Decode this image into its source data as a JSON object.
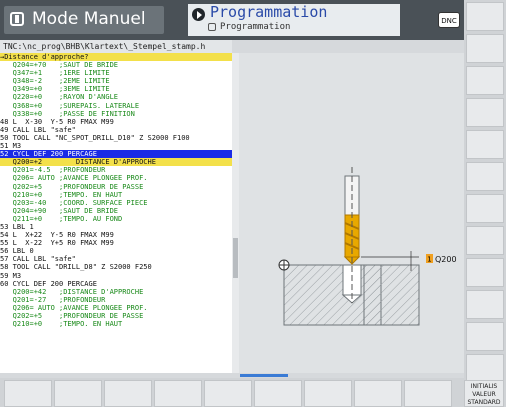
{
  "header": {
    "mode_label": "Mode Manuel",
    "program_title": "Programmation",
    "program_subtitle": "Programmation",
    "dnc_label": "DNC"
  },
  "path": "TNC:\\nc_prog\\BHB\\Klartext\\_Stempel_stamp.h",
  "program_lines": [
    {
      "text": "→Distance d'approche?",
      "style": "hdr"
    },
    {
      "text": "   Q204=+70   ;SAUT DE BRIDE",
      "style": "cm"
    },
    {
      "text": "   Q347=+1    ;1ERE LIMITE",
      "style": "cm"
    },
    {
      "text": "   Q348=-2    ;2EME LIMITE",
      "style": "cm"
    },
    {
      "text": "   Q349=+0    ;3EME LIMITE",
      "style": "cm"
    },
    {
      "text": "   Q220=+0    ;RAYON D'ANGLE",
      "style": "cm"
    },
    {
      "text": "   Q368=+0    ;SUREPAIS. LATERALE",
      "style": "cm"
    },
    {
      "text": "   Q338=+0    ;PASSE DE FINITION",
      "style": "cm"
    },
    {
      "text": "48 L  X-30  Y-5 R0 FMAX M99",
      "style": "n"
    },
    {
      "text": "49 CALL LBL \"safe\"",
      "style": "n"
    },
    {
      "text": "50 TOOL CALL \"NC_SPOT_DRILL_D10\" Z S2000 F100",
      "style": "n"
    },
    {
      "text": "51 M3",
      "style": "n"
    },
    {
      "text": "52 CYCL DEF 200 PERCAGE",
      "style": "cur"
    },
    {
      "text": "   Q200=+2        DISTANCE D'APPROCHE",
      "style": "hdr"
    },
    {
      "text": "   Q201=-4.5  ;PROFONDEUR",
      "style": "cm"
    },
    {
      "text": "   Q206= AUTO ;AVANCE PLONGEE PROF.",
      "style": "cm"
    },
    {
      "text": "   Q202=+5    ;PROFONDEUR DE PASSE",
      "style": "cm"
    },
    {
      "text": "   Q210=+0    ;TEMPO. EN HAUT",
      "style": "cm"
    },
    {
      "text": "   Q203=-40   ;COORD. SURFACE PIECE",
      "style": "cm"
    },
    {
      "text": "   Q204=+90   ;SAUT DE BRIDE",
      "style": "cm"
    },
    {
      "text": "   Q211=+0    ;TEMPO. AU FOND",
      "style": "cm"
    },
    {
      "text": "53 LBL 1",
      "style": "n"
    },
    {
      "text": "54 L  X+22  Y-5 R0 FMAX M99",
      "style": "n"
    },
    {
      "text": "55 L  X-22  Y+5 R0 FMAX M99",
      "style": "n"
    },
    {
      "text": "56 LBL 0",
      "style": "n"
    },
    {
      "text": "57 CALL LBL \"safe\"",
      "style": "n"
    },
    {
      "text": "58 TOOL CALL \"DRILL_D8\" Z S2000 F250",
      "style": "n"
    },
    {
      "text": "59 M3",
      "style": "n"
    },
    {
      "text": "60 CYCL DEF 200 PERCAGE",
      "style": "n"
    },
    {
      "text": "   Q200=+42   ;DISTANCE D'APPROCHE",
      "style": "cm"
    },
    {
      "text": "   Q201=-27   ;PROFONDEUR",
      "style": "cm"
    },
    {
      "text": "   Q206= AUTO ;AVANCE PLONGEE PROF.",
      "style": "cm"
    },
    {
      "text": "   Q202=+5    ;PROFONDEUR DE PASSE",
      "style": "cm"
    },
    {
      "text": "   Q210=+0    ;TEMPO. EN HAUT",
      "style": "cm"
    }
  ],
  "graphic": {
    "q_label": "Q200",
    "q_badge": "1",
    "colors": {
      "drill": "#e8a800",
      "drill_dark": "#b07800",
      "q_badge": "#f0a020",
      "workpiece": "#cfd2d4"
    }
  },
  "softkeys": {
    "bottom_last": [
      "INITIALIS",
      "VALEUR",
      "STANDARD"
    ]
  }
}
